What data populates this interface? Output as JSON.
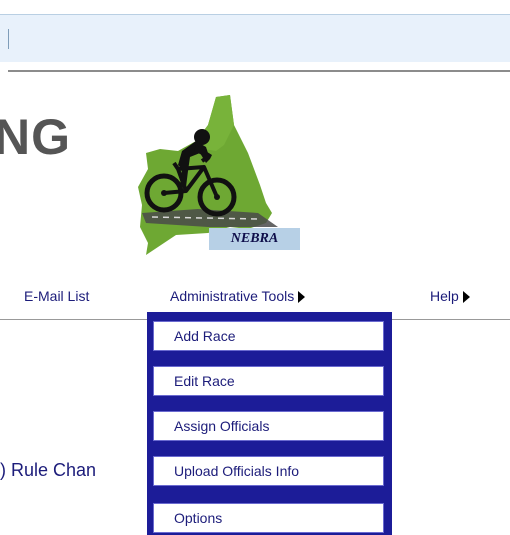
{
  "header": {
    "title_fragment": "NG"
  },
  "logo": {
    "caption": "NEBRA"
  },
  "nav": {
    "email_list": "E-Mail List",
    "admin_tools": "Administrative Tools",
    "help": "Help"
  },
  "content": {
    "rule_changes_fragment": ") Rule Chan"
  },
  "dropdown": {
    "items": [
      "Add Race",
      "Edit Race",
      "Assign Officials",
      "Upload Officials Info",
      "Options"
    ]
  },
  "colors": {
    "nav_text": "#1c1c7a",
    "dropdown_border": "#1c1c98",
    "logo_state": "#6ea833",
    "top_bar": "#e8f1fb"
  }
}
